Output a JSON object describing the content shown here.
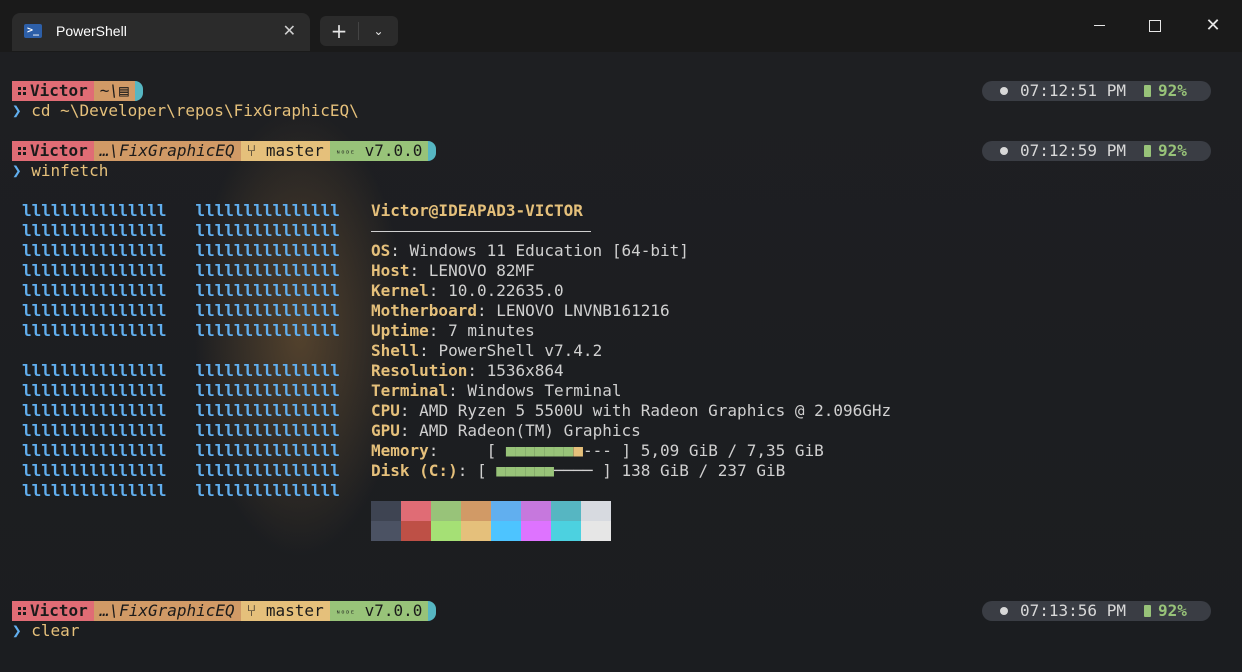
{
  "titlebar": {
    "tab_title": "PowerShell",
    "tab_icon_glyph": ">_",
    "close_glyph": "✕",
    "new_tab_glyph": "+",
    "dropdown_glyph": "⌄",
    "minimize": "",
    "maximize": "",
    "close_window_glyph": "✕"
  },
  "blocks": [
    {
      "prompt": {
        "user": "Victor",
        "path": "~\\",
        "path_icon": "📄",
        "git": "",
        "node": ""
      },
      "status": {
        "time": "07:12:51 PM",
        "battery": "92%"
      },
      "command": "cd ~\\Developer\\repos\\FixGraphicEQ\\"
    },
    {
      "prompt": {
        "user": "Victor",
        "path": "…\\FixGraphicEQ",
        "git": " master",
        "node_label": "ᴺᴼᴰᴱ",
        "node": "v7.0.0"
      },
      "status": {
        "time": "07:12:59 PM",
        "battery": "92%"
      },
      "command": "winfetch"
    },
    {
      "prompt": {
        "user": "Victor",
        "path": "…\\FixGraphicEQ",
        "git": " master",
        "node_label": "ᴺᴼᴰᴱ",
        "node": "v7.0.0"
      },
      "status": {
        "time": "07:13:56 PM",
        "battery": "92%"
      },
      "command": "clear"
    }
  ],
  "winfetch": {
    "logo_row": "lllllllllllllll   lllllllllllllll",
    "header": "Victor@IDEAPAD3-VICTOR",
    "info": [
      {
        "key": "OS",
        "value": "Windows 11 Education [64-bit]"
      },
      {
        "key": "Host",
        "value": "LENOVO 82MF"
      },
      {
        "key": "Kernel",
        "value": "10.0.22635.0"
      },
      {
        "key": "Motherboard",
        "value": "LENOVO LNVNB161216"
      },
      {
        "key": "Uptime",
        "value": "7 minutes"
      },
      {
        "key": "Shell",
        "value": "PowerShell v7.4.2"
      },
      {
        "key": "Resolution",
        "value": "1536x864"
      },
      {
        "key": "Terminal",
        "value": "Windows Terminal"
      },
      {
        "key": "CPU",
        "value": "AMD Ryzen 5 5500U with Radeon Graphics @ 2.096GHz"
      },
      {
        "key": "GPU",
        "value": "AMD Radeon(TM) Graphics"
      }
    ],
    "memory": {
      "key": "Memory",
      "pad": "    ",
      "bar_green": "■■■■■■■",
      "bar_yellow": "■",
      "bar_rest": "---",
      "value": "5,09 GiB / 7,35 GiB"
    },
    "disk": {
      "key": "Disk (C:)",
      "bar_green": "■■■■■■",
      "bar_rest": "────",
      "value": "138 GiB / 237 GiB"
    },
    "palette_top": [
      "#3e4452",
      "#e06c75",
      "#98c379",
      "#d19a66",
      "#61afef",
      "#c678dd",
      "#56b6c2",
      "#d7dae0"
    ],
    "palette_bottom": [
      "#4b5263",
      "#be5046",
      "#a5e075",
      "#e5c07b",
      "#4dc4ff",
      "#de73ff",
      "#4cd1e0",
      "#e6e6e6"
    ]
  },
  "colors": {
    "accent_blue": "#61afef",
    "accent_yellow": "#e5c07b",
    "accent_green": "#98c379",
    "accent_red": "#e06c75"
  }
}
